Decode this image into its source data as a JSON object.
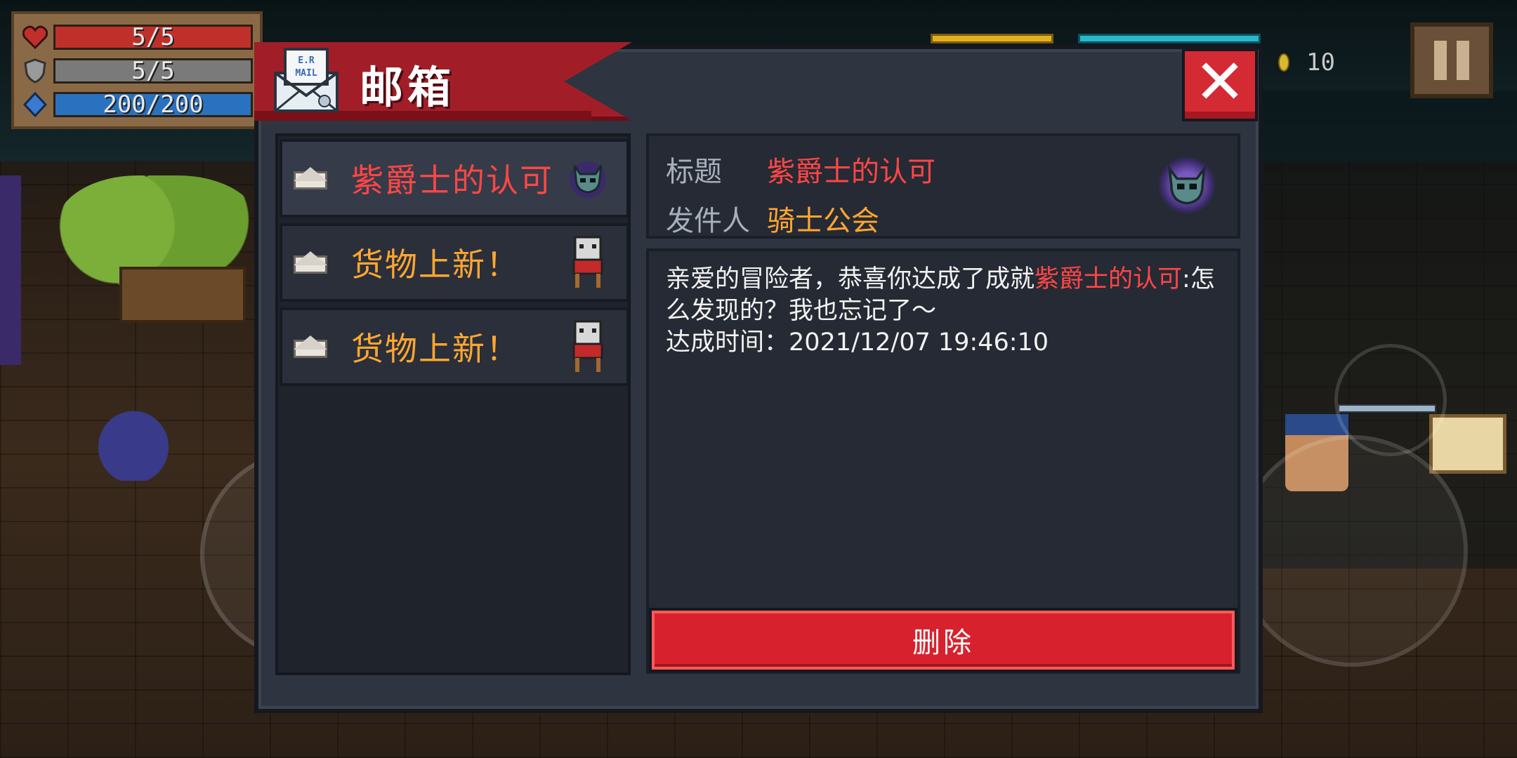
{
  "hud": {
    "hp": "5/5",
    "armor": "5/5",
    "energy": "200/200",
    "coins": "10"
  },
  "mailbox": {
    "title": "邮箱",
    "mail_icon_text": "E.R MAIL",
    "items": [
      {
        "subject": "紫爵士的认可",
        "color": "red",
        "sender_icon": "dark-knight-icon",
        "selected": true
      },
      {
        "subject": "货物上新！",
        "color": "orange",
        "sender_icon": "merchant-cat-icon",
        "selected": false
      },
      {
        "subject": "货物上新！",
        "color": "orange",
        "sender_icon": "merchant-cat-icon",
        "selected": false
      }
    ],
    "detail": {
      "title_label": "标题",
      "title_value": "紫爵士的认可",
      "sender_label": "发件人",
      "sender_value": "骑士公会",
      "body_prefix": "亲爱的冒险者，恭喜你达成了成就",
      "body_highlight": "紫爵士的认可",
      "body_suffix": ":怎么发现的？我也忘记了～",
      "time_line": "达成时间：2021/12/07 19:46:10"
    },
    "delete_label": "删除"
  },
  "colors": {
    "accent_red": "#d7222e",
    "subject_red": "#ff4646",
    "subject_orange": "#ffa632",
    "panel": "#2e3440"
  }
}
